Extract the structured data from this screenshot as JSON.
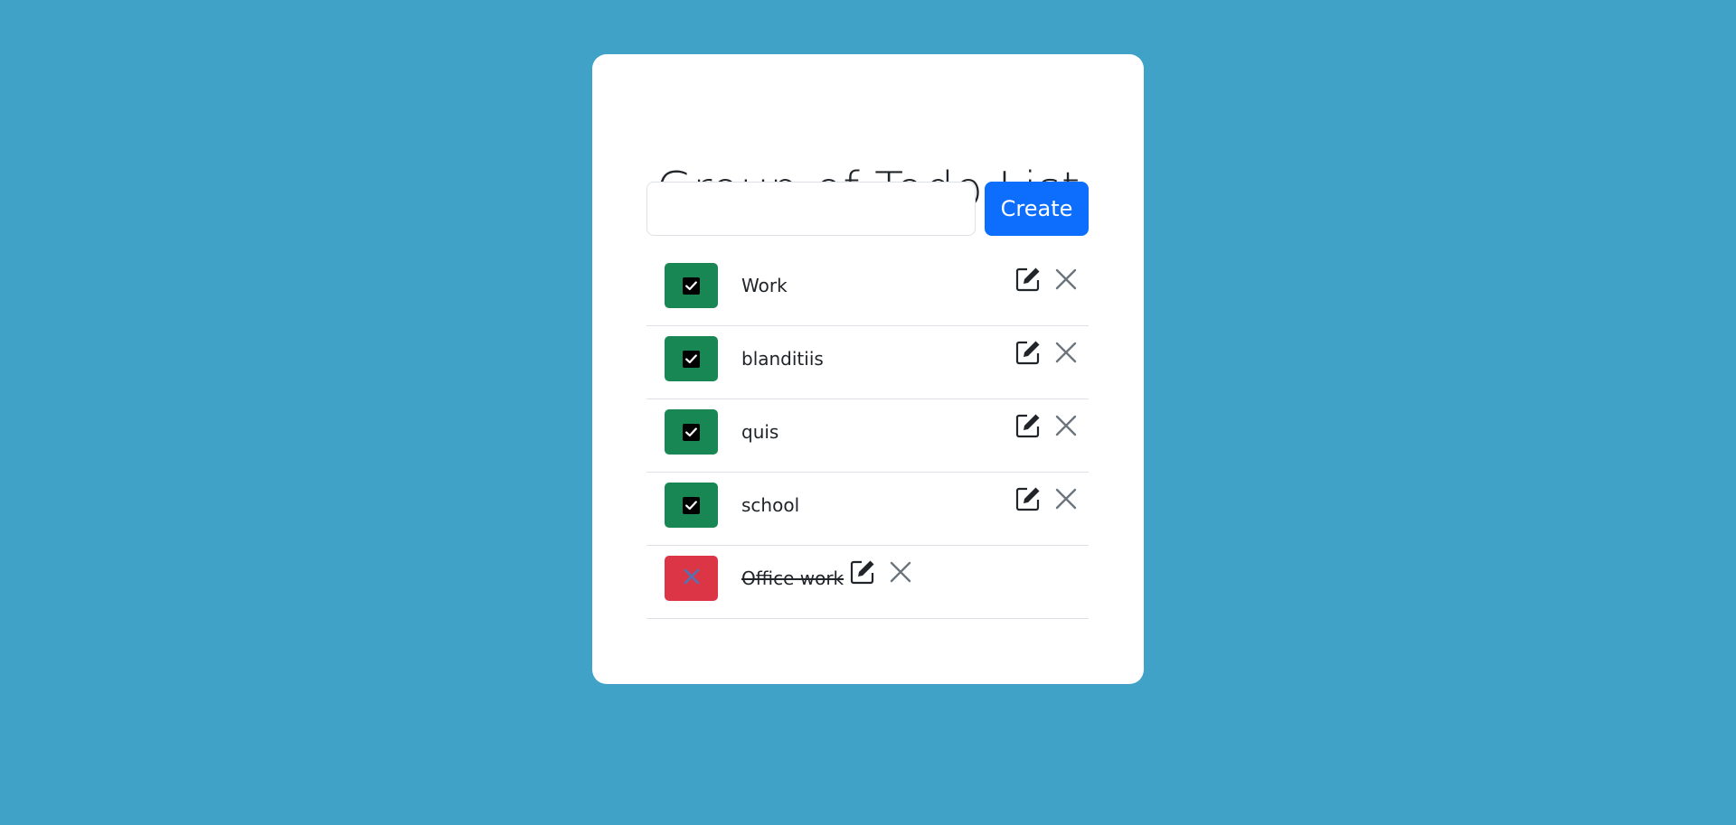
{
  "title": "Group of Todo List",
  "create": {
    "input_value": "",
    "placeholder": "",
    "button_label": "Create"
  },
  "todos": [
    {
      "label": "Work",
      "done": true
    },
    {
      "label": "blanditiis",
      "done": true
    },
    {
      "label": "quis",
      "done": true
    },
    {
      "label": "school",
      "done": true
    },
    {
      "label": "Office work",
      "done": false
    }
  ],
  "colors": {
    "background": "#3fa2c6",
    "primary": "#0d6efd",
    "done": "#198754",
    "undone": "#dc3545"
  },
  "icons": {
    "edit": "edit-icon",
    "delete": "close-icon",
    "checked": "checkbox-checked-icon",
    "not_done": "x-mark-icon"
  }
}
